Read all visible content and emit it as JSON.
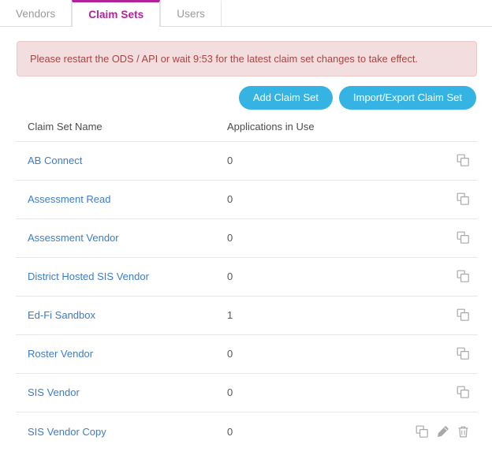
{
  "tabs": [
    {
      "label": "Vendors",
      "active": false
    },
    {
      "label": "Claim Sets",
      "active": true
    },
    {
      "label": "Users",
      "active": false
    }
  ],
  "alert": {
    "message": "Please restart the ODS / API or wait 9:53 for the latest claim set changes to take effect.",
    "timer": "9:53",
    "background_color": "#f2dede",
    "text_color": "#a94442"
  },
  "toolbar": {
    "add_label": "Add Claim Set",
    "import_export_label": "Import/Export Claim Set",
    "button_color": "#35b4e4"
  },
  "table": {
    "headers": {
      "name": "Claim Set Name",
      "applications": "Applications in Use",
      "actions": ""
    },
    "rows": [
      {
        "name": "AB Connect",
        "applications": "0",
        "actions": [
          "copy-icon"
        ]
      },
      {
        "name": "Assessment Read",
        "applications": "0",
        "actions": [
          "copy-icon"
        ]
      },
      {
        "name": "Assessment Vendor",
        "applications": "0",
        "actions": [
          "copy-icon"
        ]
      },
      {
        "name": "District Hosted SIS Vendor",
        "applications": "0",
        "actions": [
          "copy-icon"
        ]
      },
      {
        "name": "Ed-Fi Sandbox",
        "applications": "1",
        "actions": [
          "copy-icon"
        ]
      },
      {
        "name": "Roster Vendor",
        "applications": "0",
        "actions": [
          "copy-icon"
        ]
      },
      {
        "name": "SIS Vendor",
        "applications": "0",
        "actions": [
          "copy-icon"
        ]
      },
      {
        "name": "SIS Vendor Copy",
        "applications": "0",
        "actions": [
          "copy-icon",
          "edit-icon",
          "delete-icon"
        ]
      }
    ]
  },
  "colors": {
    "active_tab": "#b2229a",
    "link": "#3d7cc9",
    "icon": "#a8a8a8",
    "divider": "#e6e6e6"
  }
}
